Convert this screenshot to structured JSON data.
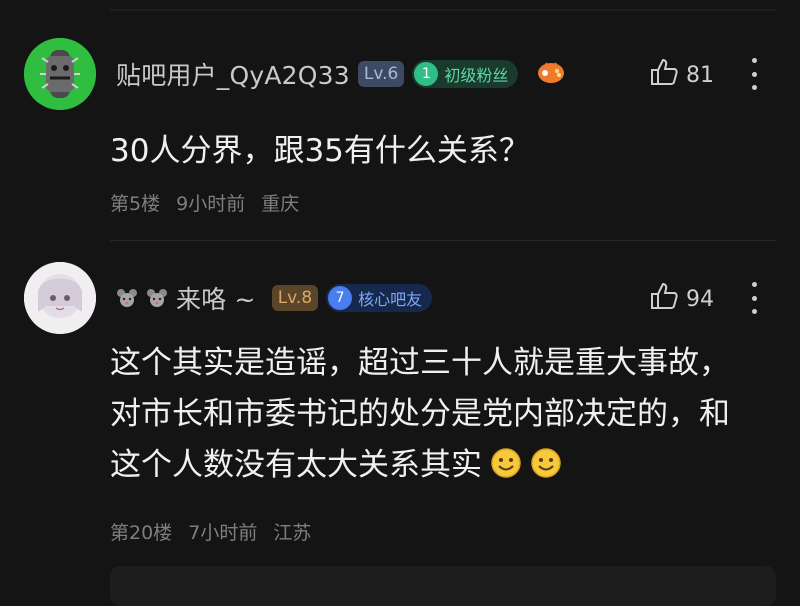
{
  "comments": [
    {
      "username": "贴吧用户_QyA2Q33",
      "level": "Lv.6",
      "badge_number": "1",
      "badge_label": "初级粉丝",
      "likes": "81",
      "text_lines": [
        "30人分界，跟35有什么关系？"
      ],
      "floor": "第5楼",
      "time": "9小时前",
      "location": "重庆"
    },
    {
      "username": "来咯 ~",
      "level": "Lv.8",
      "badge_number": "7",
      "badge_label": "核心吧友",
      "likes": "94",
      "text_lines": [
        "这个其实是造谣，超过三十人就是重大事故，",
        "对市长和市委书记的处分是党内部决定的，和",
        "这个人数没有太大关系其实"
      ],
      "floor": "第20楼",
      "time": "7小时前",
      "location": "江苏"
    }
  ],
  "icons": {
    "like": "thumbs-up-icon",
    "more": "more-vertical-icon",
    "smile": "smile-emoji-icon",
    "mouse": "mouse-emoji-icon",
    "game": "gamepad-icon"
  },
  "colors": {
    "background": "#141414",
    "level6": "#3d4a63",
    "level8": "#5a4529",
    "badge_green": "#2fbf86",
    "badge_blue": "#4a7df0"
  }
}
